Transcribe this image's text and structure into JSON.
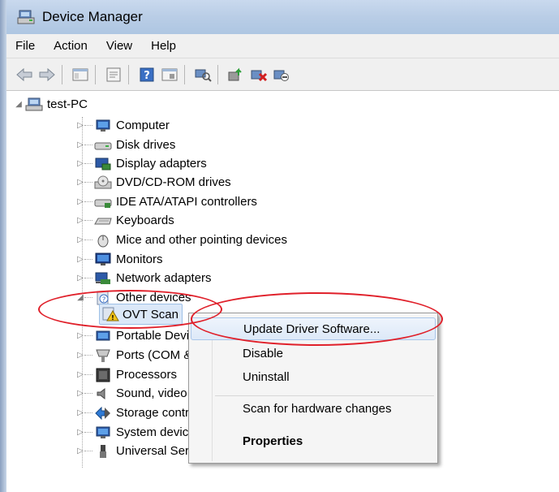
{
  "window": {
    "title": "Device Manager"
  },
  "menu": [
    "File",
    "Action",
    "View",
    "Help"
  ],
  "toolbar": {
    "buttons": [
      "back-icon",
      "forward-icon",
      "show-hide-icon",
      "properties-icon",
      "help-icon",
      "view-icon",
      "scan-icon",
      "update-driver-icon",
      "uninstall-icon",
      "disable-icon"
    ]
  },
  "tree": {
    "root": "test-PC",
    "items": [
      "Computer",
      "Disk drives",
      "Display adapters",
      "DVD/CD-ROM drives",
      "IDE ATA/ATAPI controllers",
      "Keyboards",
      "Mice and other pointing devices",
      "Monitors",
      "Network adapters",
      "Other devices",
      "OVT Scan",
      "Portable Devic",
      "Ports (COM &",
      "Processors",
      "Sound, video",
      "Storage contr",
      "System device",
      "Universal Seria"
    ]
  },
  "context_menu": {
    "items": [
      "Update Driver Software...",
      "Disable",
      "Uninstall",
      "Scan for hardware changes",
      "Properties"
    ]
  },
  "colors": {
    "highlight_ring": "#e0202a",
    "title_bar": "#b9cde6"
  }
}
